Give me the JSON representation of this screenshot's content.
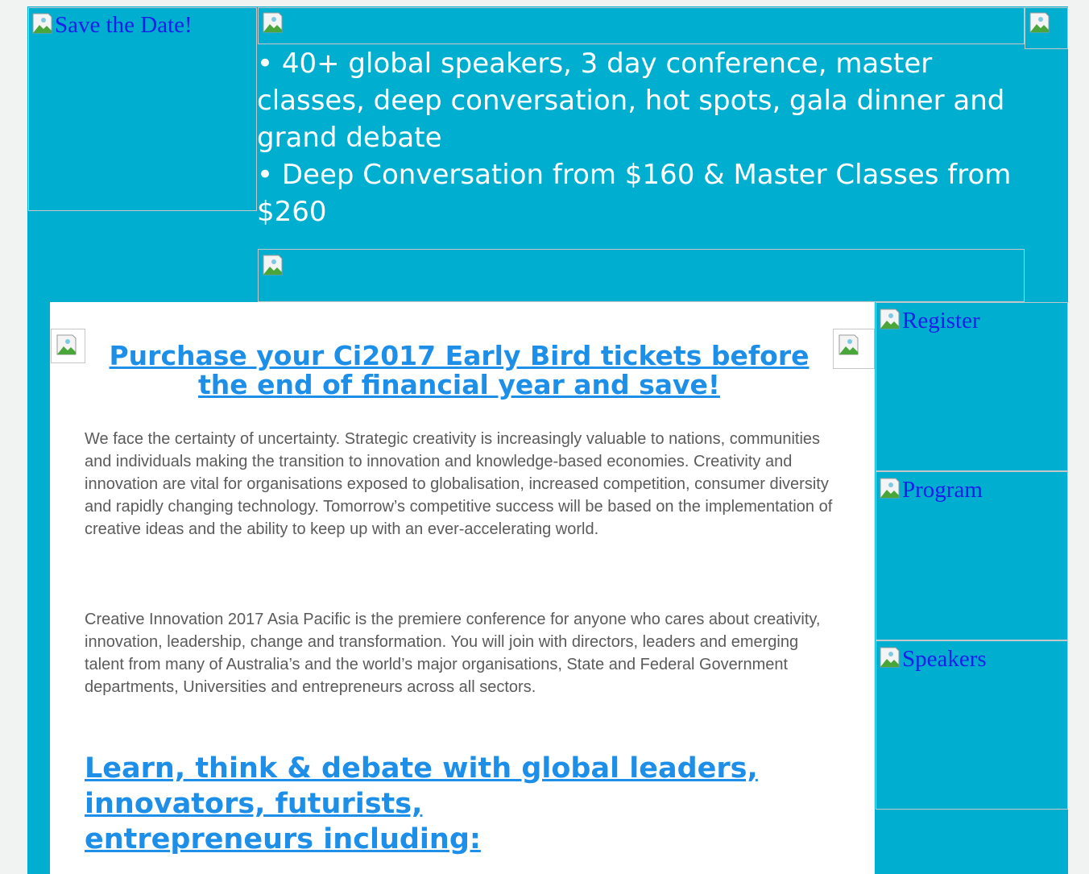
{
  "header": {
    "save_the_date_alt": "Save the Date!",
    "bullets": [
      "• 40+ global speakers, 3 day conference, master classes, deep conversation, hot spots, gala dinner and grand debate",
      "• Deep Conversation from $160 & Master Classes from $260"
    ]
  },
  "main": {
    "headline": "Purchase your Ci2017 Early Bird tickets before the end of financial year and save!",
    "paragraphs": [
      "We face the certainty of uncertainty. Strategic creativity is increasingly valuable to nations, communities and individuals making the transition to innovation and knowledge-based economies. Creativity and innovation are vital for organisations exposed to globalisation, increased competition, consumer diversity and rapidly changing technology. Tomorrow’s competitive success will be based on the implementation of creative ideas and the ability to keep up with an ever-accelerating world.",
      "Creative Innovation 2017 Asia Pacific is the premiere conference for anyone who cares about creativity, innovation, leadership, change and transformation. You will join with directors, leaders and emerging talent from many of Australia’s and the world’s major organisations, State and Federal Government departments, Universities and entrepreneurs across all sectors."
    ],
    "subheading_lines": [
      "Learn, think & debate with global leaders,",
      "innovators, futurists,",
      "entrepreneurs including:"
    ]
  },
  "sidebar": {
    "items": [
      {
        "alt": "Register"
      },
      {
        "alt": "Program"
      },
      {
        "alt": "Speakers"
      }
    ]
  },
  "colors": {
    "banner_background": "#00aecf",
    "link_blue": "#1d8fe8",
    "alt_text_blue": "#1c1ee8",
    "body_text": "#5b5b5b"
  },
  "icons": [
    "broken-image-icon"
  ]
}
